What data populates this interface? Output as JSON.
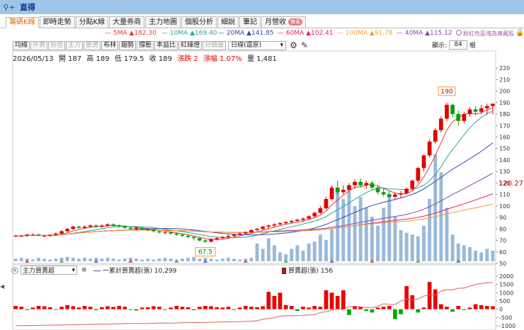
{
  "window": {
    "title": "直得",
    "icon": "search-icon"
  },
  "tabs": [
    {
      "label": "籌碼K線",
      "active": true
    },
    {
      "label": "即時走勢"
    },
    {
      "label": "分點K線"
    },
    {
      "label": "大量券商"
    },
    {
      "label": "主力地圖"
    },
    {
      "label": "個股分析"
    },
    {
      "label": "細說"
    },
    {
      "label": "筆記"
    },
    {
      "label": "月營收",
      "badge": "無表"
    }
  ],
  "ma": [
    {
      "label": "5MA",
      "value": "▲182.30",
      "color": "#e53935"
    },
    {
      "label": "10MA",
      "value": "▲169.40",
      "color": "#26a69a"
    },
    {
      "label": "20MA",
      "value": "▲141.85",
      "color": "#3949ab"
    },
    {
      "label": "60MA",
      "value": "▲102.41",
      "color": "#e91e63"
    },
    {
      "label": "100MA",
      "value": "▲91.78",
      "color": "#f0a030"
    },
    {
      "label": "40MA",
      "value": "▲115.12",
      "color": "#8e44ad"
    }
  ],
  "hint": "粉紅色區塊為庫藏股",
  "toolbar": {
    "buttons": [
      {
        "label": "均線"
      },
      {
        "label": "外資",
        "disabled": true
      },
      {
        "label": "投信",
        "disabled": true
      },
      {
        "label": "主力",
        "disabled": true
      },
      {
        "label": "散資",
        "disabled": true
      },
      {
        "label": "布林"
      },
      {
        "label": "趨勢"
      },
      {
        "label": "撐壓"
      },
      {
        "label": "本益比"
      },
      {
        "label": "紅綠燈"
      },
      {
        "label": "分價量",
        "disabled": true
      }
    ],
    "period": "日線(還原)",
    "display_label": "顯示:",
    "display_value": "84",
    "display_unit": "根"
  },
  "info": {
    "date": "2026/05/13",
    "open": "開 187",
    "high": "高 189",
    "low": "低 179.5",
    "close": "收 189",
    "change": "漲跌 2",
    "pct": "漲幅 1.07%",
    "volume": "量 1,481"
  },
  "chart_data": [
    {
      "type": "candlestick",
      "ylim": [
        50,
        225
      ],
      "yticks": [
        "220",
        "210",
        "200",
        "190",
        "180",
        "170",
        "160",
        "150",
        "140",
        "130",
        "120",
        "110",
        "100",
        "90",
        "80",
        "70",
        "60",
        "50"
      ],
      "current_price_label": "120.27",
      "high_label": "190",
      "low_label": "67.5",
      "colors": {
        "up": "#e00000",
        "down": "#00a000",
        "volume": "#9bb9d9"
      },
      "candles": [
        [
          74,
          75,
          73,
          74
        ],
        [
          74,
          75,
          73,
          74
        ],
        [
          74,
          76,
          73,
          75
        ],
        [
          75,
          76,
          74,
          75
        ],
        [
          75,
          76,
          74,
          74
        ],
        [
          74,
          75,
          73,
          74
        ],
        [
          74,
          75,
          73,
          75
        ],
        [
          75,
          77,
          74,
          76
        ],
        [
          76,
          79,
          75,
          78
        ],
        [
          78,
          81,
          77,
          80
        ],
        [
          80,
          83,
          79,
          82
        ],
        [
          82,
          83,
          80,
          81
        ],
        [
          81,
          83,
          80,
          82
        ],
        [
          82,
          84,
          81,
          83
        ],
        [
          83,
          84,
          81,
          82
        ],
        [
          82,
          84,
          81,
          83
        ],
        [
          83,
          85,
          82,
          84
        ],
        [
          84,
          85,
          82,
          83
        ],
        [
          83,
          84,
          81,
          82
        ],
        [
          82,
          83,
          80,
          81
        ],
        [
          81,
          82,
          79,
          80
        ],
        [
          80,
          82,
          79,
          81
        ],
        [
          81,
          82,
          79,
          80
        ],
        [
          80,
          81,
          78,
          79
        ],
        [
          79,
          80,
          77,
          78
        ],
        [
          78,
          79,
          76,
          77
        ],
        [
          77,
          78,
          75,
          77
        ],
        [
          77,
          78,
          75,
          76
        ],
        [
          76,
          77,
          74,
          75
        ],
        [
          75,
          76,
          73,
          74
        ],
        [
          74,
          75,
          72,
          73
        ],
        [
          73,
          74,
          70,
          72
        ],
        [
          72,
          73,
          69,
          70
        ],
        [
          70,
          71,
          67.5,
          69
        ],
        [
          69,
          72,
          68,
          71
        ],
        [
          71,
          73,
          70,
          72
        ],
        [
          72,
          74,
          71,
          73
        ],
        [
          73,
          75,
          72,
          74
        ],
        [
          74,
          76,
          73,
          75
        ],
        [
          75,
          77,
          74,
          76
        ],
        [
          76,
          78,
          75,
          77
        ],
        [
          77,
          80,
          76,
          79
        ],
        [
          79,
          81,
          78,
          80
        ],
        [
          80,
          83,
          79,
          82
        ],
        [
          82,
          84,
          80,
          83
        ],
        [
          83,
          85,
          81,
          84
        ],
        [
          84,
          86,
          83,
          85
        ],
        [
          85,
          87,
          84,
          86
        ],
        [
          86,
          88,
          85,
          87
        ],
        [
          87,
          89,
          86,
          88
        ],
        [
          88,
          90,
          86,
          89
        ],
        [
          89,
          92,
          88,
          91
        ],
        [
          91,
          95,
          90,
          94
        ],
        [
          94,
          100,
          93,
          98
        ],
        [
          98,
          108,
          97,
          106
        ],
        [
          106,
          118,
          105,
          116
        ],
        [
          116,
          122,
          110,
          112
        ],
        [
          112,
          118,
          110,
          114
        ],
        [
          114,
          120,
          112,
          118
        ],
        [
          118,
          123,
          115,
          121
        ],
        [
          121,
          124,
          116,
          118
        ],
        [
          118,
          122,
          115,
          120
        ],
        [
          120,
          122,
          114,
          116
        ],
        [
          116,
          118,
          110,
          112
        ],
        [
          112,
          115,
          108,
          110
        ],
        [
          110,
          113,
          107,
          108
        ],
        [
          108,
          112,
          106,
          110
        ],
        [
          110,
          113,
          107,
          111
        ],
        [
          111,
          116,
          110,
          115
        ],
        [
          115,
          123,
          113,
          122
        ],
        [
          122,
          134,
          120,
          133
        ],
        [
          133,
          145,
          130,
          144
        ],
        [
          144,
          158,
          142,
          156
        ],
        [
          156,
          168,
          154,
          166
        ],
        [
          166,
          178,
          164,
          176
        ],
        [
          176,
          190,
          174,
          188
        ],
        [
          188,
          189,
          177,
          180
        ],
        [
          180,
          183,
          170,
          174
        ],
        [
          174,
          182,
          172,
          180
        ],
        [
          180,
          186,
          178,
          184
        ],
        [
          184,
          187,
          179,
          182
        ],
        [
          182,
          188,
          180,
          185
        ],
        [
          185,
          189,
          179.5,
          187
        ],
        [
          187,
          189,
          179.5,
          189
        ]
      ],
      "volumes": [
        3,
        4,
        3,
        2,
        4,
        3,
        2,
        3,
        4,
        5,
        4,
        3,
        4,
        3,
        4,
        3,
        4,
        3,
        2,
        3,
        4,
        3,
        2,
        3,
        2,
        3,
        4,
        3,
        2,
        3,
        4,
        5,
        3,
        4,
        3,
        2,
        3,
        4,
        3,
        2,
        3,
        4,
        20,
        14,
        26,
        18,
        10,
        8,
        14,
        18,
        12,
        20,
        22,
        30,
        24,
        36,
        78,
        70,
        78,
        62,
        72,
        60,
        50,
        40,
        60,
        76,
        50,
        35,
        32,
        30,
        28,
        40,
        70,
        120,
        100,
        60,
        30,
        20,
        18,
        16,
        12,
        10,
        14,
        12
      ]
    },
    {
      "type": "bar",
      "title": "主力買賣超",
      "series": [
        {
          "name": "一累計買賣超(張)",
          "value_label": "10,299"
        },
        {
          "name": "買賣超(張)",
          "value_label": "156"
        }
      ],
      "ylim": [
        -1000,
        2000
      ],
      "yticks": [
        "2000",
        "1500",
        "1000",
        "500",
        "0",
        "-500",
        "-1000"
      ],
      "values": [
        200,
        150,
        -50,
        100,
        200,
        180,
        120,
        -40,
        150,
        250,
        180,
        100,
        200,
        150,
        -60,
        120,
        180,
        140,
        200,
        150,
        -40,
        -80,
        100,
        120,
        180,
        150,
        -30,
        100,
        200,
        150,
        120,
        -60,
        150,
        200,
        180,
        120,
        100,
        150,
        -40,
        100,
        200,
        150,
        120,
        180,
        1050,
        800,
        1000,
        250,
        200,
        -100,
        150,
        100,
        200,
        150,
        1150,
        1000,
        800,
        1150,
        -350,
        200,
        150,
        -100,
        -200,
        100,
        150,
        200,
        -600,
        -300,
        1400,
        850,
        -200,
        100,
        1650,
        1200,
        300,
        150,
        -150,
        200,
        -50,
        100,
        300,
        250,
        200,
        180
      ],
      "cumulative": [
        -1000,
        -990,
        -985,
        -990,
        -980,
        -970,
        -960,
        -955,
        -958,
        -950,
        -940,
        -930,
        -925,
        -915,
        -905,
        -908,
        -900,
        -890,
        -880,
        -870,
        -862,
        -864,
        -868,
        -862,
        -850,
        -840,
        -835,
        -836,
        -830,
        -820,
        -810,
        -805,
        -808,
        -800,
        -790,
        -780,
        -770,
        -760,
        -758,
        -750,
        -740,
        -725,
        -700,
        -600,
        -560,
        -520,
        -420,
        -390,
        -400,
        -385,
        -370,
        -350,
        -330,
        -200,
        -150,
        -60,
        20,
        -20,
        150,
        180,
        140,
        100,
        110,
        180,
        330,
        300,
        280,
        500,
        620,
        580,
        620,
        800,
        850,
        860,
        1100,
        1180,
        1170,
        1270,
        1280,
        1400,
        1500,
        1560,
        1600,
        1620
      ]
    }
  ],
  "lower": {
    "select": "主力買賣超",
    "legend1_name": "一累計買賣超(張)",
    "legend1_value": "10,299",
    "legend2_name": "買賣超(張)",
    "legend2_value": "156"
  }
}
